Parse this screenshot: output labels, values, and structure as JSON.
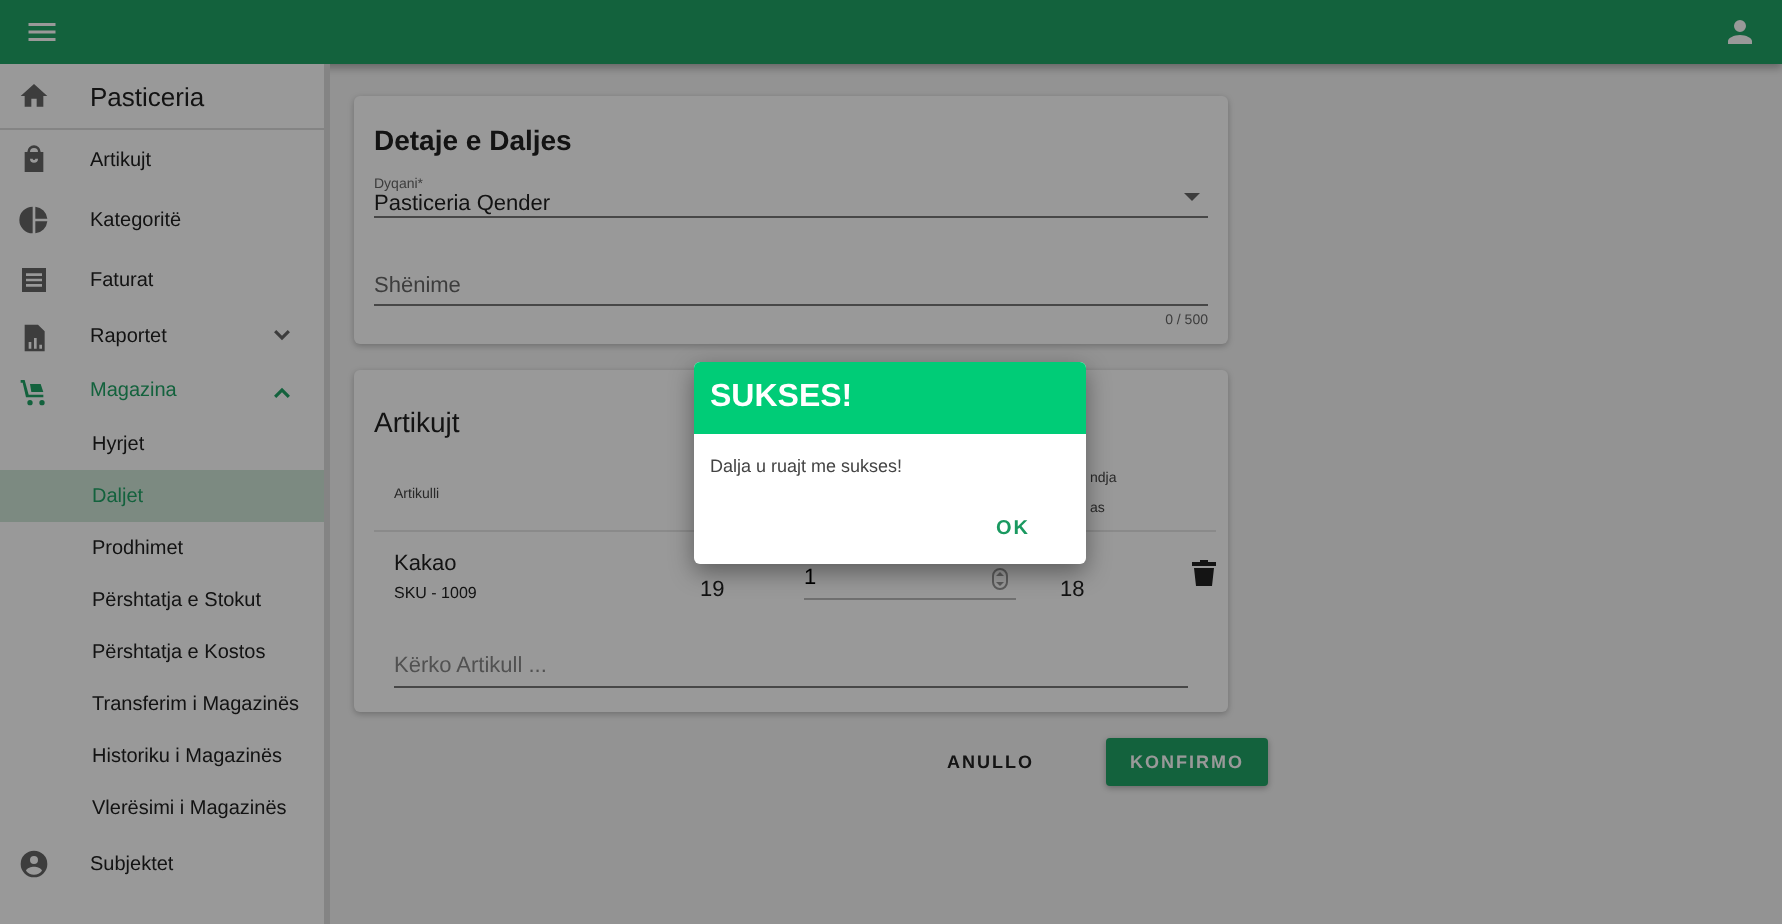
{
  "sidebar": {
    "title": "Pasticeria",
    "items": [
      {
        "label": "Artikujt",
        "kind": "link",
        "selected": false
      },
      {
        "label": "Kategoritë",
        "kind": "link",
        "selected": false
      },
      {
        "label": "Faturat",
        "kind": "link",
        "selected": false
      },
      {
        "label": "Raportet",
        "kind": "group",
        "expanded": false
      },
      {
        "label": "Magazina",
        "kind": "group",
        "expanded": true,
        "children": [
          {
            "label": "Hyrjet",
            "selected": false
          },
          {
            "label": "Daljet",
            "selected": true
          },
          {
            "label": "Prodhimet",
            "selected": false
          },
          {
            "label": "Përshtatja e Stokut",
            "selected": false
          },
          {
            "label": "Përshtatja e Kostos",
            "selected": false
          },
          {
            "label": "Transferim i Magazinës",
            "selected": false
          },
          {
            "label": "Historiku i Magazinës",
            "selected": false
          },
          {
            "label": "Vlerësimi i Magazinës",
            "selected": false
          }
        ]
      },
      {
        "label": "Subjektet",
        "kind": "link",
        "selected": false
      }
    ]
  },
  "details": {
    "title": "Detaje e Daljes",
    "store": {
      "label": "Dyqani*",
      "value": "Pasticeria Qender"
    },
    "notes": {
      "placeholder": "Shënime",
      "counter": "0 / 500"
    }
  },
  "items": {
    "title": "Artikujt",
    "columns": [
      "Artikulli",
      "ndja as"
    ],
    "rows": [
      {
        "name": "Kakao",
        "sku": "SKU - 1009",
        "column_2": "19",
        "quantity": "1",
        "column_4": "18"
      }
    ],
    "search": {
      "placeholder": "Kërko Artikull ..."
    }
  },
  "actions": [
    {
      "label": "ANULLO",
      "kind": "text"
    },
    {
      "label": "KONFIRMO",
      "kind": "primary"
    }
  ],
  "dialog": {
    "title": "SUKSES!",
    "message": "Dalja u ruajt me sukses!",
    "button": "OK"
  }
}
